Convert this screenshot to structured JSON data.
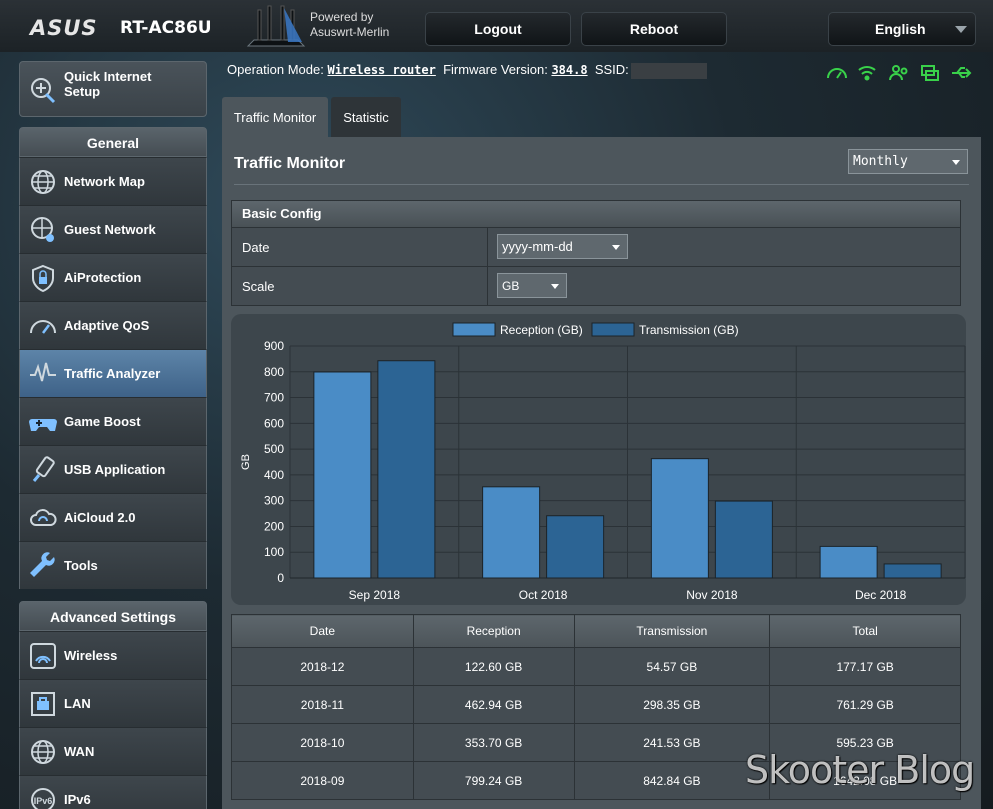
{
  "header": {
    "brand": "ASUS",
    "model": "RT-AC86U",
    "powered_line1": "Powered by",
    "powered_line2": "Asuswrt-Merlin",
    "logout": "Logout",
    "reboot": "Reboot",
    "language": "English"
  },
  "sidebar": {
    "quick_setup_line1": "Quick Internet",
    "quick_setup_line2": "Setup",
    "general_title": "General",
    "general_items": [
      {
        "label": "Network Map",
        "icon": "globe-icon"
      },
      {
        "label": "Guest Network",
        "icon": "guest-network-icon"
      },
      {
        "label": "AiProtection",
        "icon": "shield-icon"
      },
      {
        "label": "Adaptive QoS",
        "icon": "gauge-icon"
      },
      {
        "label": "Traffic Analyzer",
        "icon": "waveform-icon",
        "active": true
      },
      {
        "label": "Game Boost",
        "icon": "gamepad-icon"
      },
      {
        "label": "USB Application",
        "icon": "usb-icon"
      },
      {
        "label": "AiCloud 2.0",
        "icon": "cloud-icon"
      },
      {
        "label": "Tools",
        "icon": "wrench-icon"
      }
    ],
    "advanced_title": "Advanced Settings",
    "advanced_items": [
      {
        "label": "Wireless",
        "icon": "wifi-icon"
      },
      {
        "label": "LAN",
        "icon": "lan-icon"
      },
      {
        "label": "WAN",
        "icon": "globe-icon"
      },
      {
        "label": "IPv6",
        "icon": "ipv6-icon"
      }
    ]
  },
  "status_bar": {
    "operation_mode_label": "Operation Mode:",
    "operation_mode_value": "Wireless router",
    "firmware_label": "Firmware Version:",
    "firmware_value": "384.8",
    "ssid_label": "SSID:"
  },
  "tabs": [
    {
      "label": "Traffic Monitor",
      "active": true
    },
    {
      "label": "Statistic",
      "active": false
    }
  ],
  "panel": {
    "title": "Traffic Monitor",
    "period": "Monthly",
    "basic_config_title": "Basic Config",
    "date_label": "Date",
    "date_value": "yyyy-mm-dd",
    "scale_label": "Scale",
    "scale_value": "GB"
  },
  "colors": {
    "reception": "#4a8cc6",
    "transmission": "#2c6494"
  },
  "chart_data": {
    "type": "bar",
    "categories": [
      "Sep 2018",
      "Oct 2018",
      "Nov 2018",
      "Dec 2018"
    ],
    "series": [
      {
        "name": "Reception (GB)",
        "values": [
          799.24,
          353.7,
          462.94,
          122.6
        ]
      },
      {
        "name": "Transmission (GB)",
        "values": [
          842.84,
          241.53,
          298.35,
          54.57
        ]
      }
    ],
    "ylabel": "GB",
    "ylim": [
      0,
      900
    ],
    "yticks": [
      0,
      100,
      200,
      300,
      400,
      500,
      600,
      700,
      800,
      900
    ],
    "legend": "top-center",
    "grid": true
  },
  "table": {
    "headers": [
      "Date",
      "Reception",
      "Transmission",
      "Total"
    ],
    "rows": [
      [
        "2018-12",
        "122.60 GB",
        "54.57 GB",
        "177.17 GB"
      ],
      [
        "2018-11",
        "462.94 GB",
        "298.35 GB",
        "761.29 GB"
      ],
      [
        "2018-10",
        "353.70 GB",
        "241.53 GB",
        "595.23 GB"
      ],
      [
        "2018-09",
        "799.24 GB",
        "842.84 GB",
        "1642.08 GB"
      ]
    ]
  },
  "watermark": "Skooter Blog"
}
